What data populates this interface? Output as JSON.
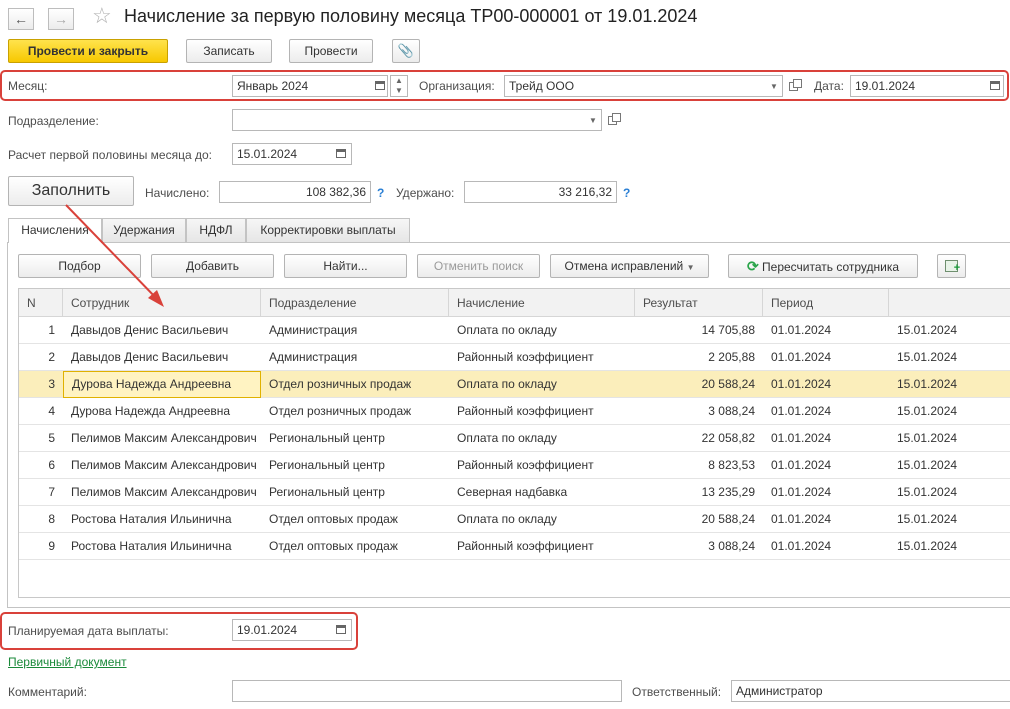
{
  "header": {
    "back_glyph": "←",
    "forward_glyph": "→",
    "star_glyph": "☆",
    "title": "Начисление за первую половину месяца ТР00-000001 от 19.01.2024"
  },
  "toolbar": {
    "post_and_close": "Провести и закрыть",
    "save": "Записать",
    "post": "Провести",
    "attach_glyph": "📎"
  },
  "form": {
    "month_label": "Месяц:",
    "month_value": "Январь 2024",
    "org_label": "Организация:",
    "org_value": "Трейд ООО",
    "date_label": "Дата:",
    "date_value": "19.01.2024",
    "dept_label": "Подразделение:",
    "dept_value": "",
    "calc_until_label": "Расчет первой половины месяца до:",
    "calc_until_value": "15.01.2024",
    "fill_button": "Заполнить",
    "accrued_label": "Начислено:",
    "accrued_value": "108 382,36",
    "withheld_label": "Удержано:",
    "withheld_value": "33 216,32",
    "help_glyph": "?"
  },
  "tabs": [
    {
      "label": "Начисления"
    },
    {
      "label": "Удержания"
    },
    {
      "label": "НДФЛ"
    },
    {
      "label": "Корректировки выплаты"
    }
  ],
  "table_toolbar": {
    "select": "Подбор",
    "add": "Добавить",
    "find": "Найти...",
    "cancel_search": "Отменить поиск",
    "cancel_corrections": "Отмена исправлений",
    "recalc": "Пересчитать сотрудника"
  },
  "table": {
    "columns": [
      "N",
      "Сотрудник",
      "Подразделение",
      "Начисление",
      "Результат",
      "Период",
      ""
    ],
    "rows": [
      {
        "n": "1",
        "employee": "Давыдов Денис Васильевич",
        "dept": "Администрация",
        "accrual": "Оплата по окладу",
        "result": "14 705,88",
        "from": "01.01.2024",
        "to": "15.01.2024"
      },
      {
        "n": "2",
        "employee": "Давыдов Денис Васильевич",
        "dept": "Администрация",
        "accrual": "Районный коэффициент",
        "result": "2 205,88",
        "from": "01.01.2024",
        "to": "15.01.2024"
      },
      {
        "n": "3",
        "employee": "Дурова Надежда Андреевна",
        "dept": "Отдел розничных продаж",
        "accrual": "Оплата по окладу",
        "result": "20 588,24",
        "from": "01.01.2024",
        "to": "15.01.2024"
      },
      {
        "n": "4",
        "employee": "Дурова Надежда Андреевна",
        "dept": "Отдел розничных продаж",
        "accrual": "Районный коэффициент",
        "result": "3 088,24",
        "from": "01.01.2024",
        "to": "15.01.2024"
      },
      {
        "n": "5",
        "employee": "Пелимов Максим Александрович",
        "dept": "Региональный центр",
        "accrual": "Оплата по окладу",
        "result": "22 058,82",
        "from": "01.01.2024",
        "to": "15.01.2024"
      },
      {
        "n": "6",
        "employee": "Пелимов Максим Александрович",
        "dept": "Региональный центр",
        "accrual": "Районный коэффициент",
        "result": "8 823,53",
        "from": "01.01.2024",
        "to": "15.01.2024"
      },
      {
        "n": "7",
        "employee": "Пелимов Максим Александрович",
        "dept": "Региональный центр",
        "accrual": "Северная надбавка",
        "result": "13 235,29",
        "from": "01.01.2024",
        "to": "15.01.2024"
      },
      {
        "n": "8",
        "employee": "Ростова Наталия Ильинична",
        "dept": "Отдел оптовых продаж",
        "accrual": "Оплата по окладу",
        "result": "20 588,24",
        "from": "01.01.2024",
        "to": "15.01.2024"
      },
      {
        "n": "9",
        "employee": "Ростова Наталия Ильинична",
        "dept": "Отдел оптовых продаж",
        "accrual": "Районный коэффициент",
        "result": "3 088,24",
        "from": "01.01.2024",
        "to": "15.01.2024"
      }
    ]
  },
  "footer": {
    "planned_date_label": "Планируемая дата выплаты:",
    "planned_date_value": "19.01.2024",
    "primary_doc_link": "Первичный документ",
    "comment_label": "Комментарий:",
    "comment_value": "",
    "responsible_label": "Ответственный:",
    "responsible_value": "Администратор"
  },
  "colors": {
    "highlight_red": "#d9413a",
    "primary_yellow": "#f7c800",
    "selected_row": "#fbeebb",
    "link_green": "#1a8a3a"
  }
}
